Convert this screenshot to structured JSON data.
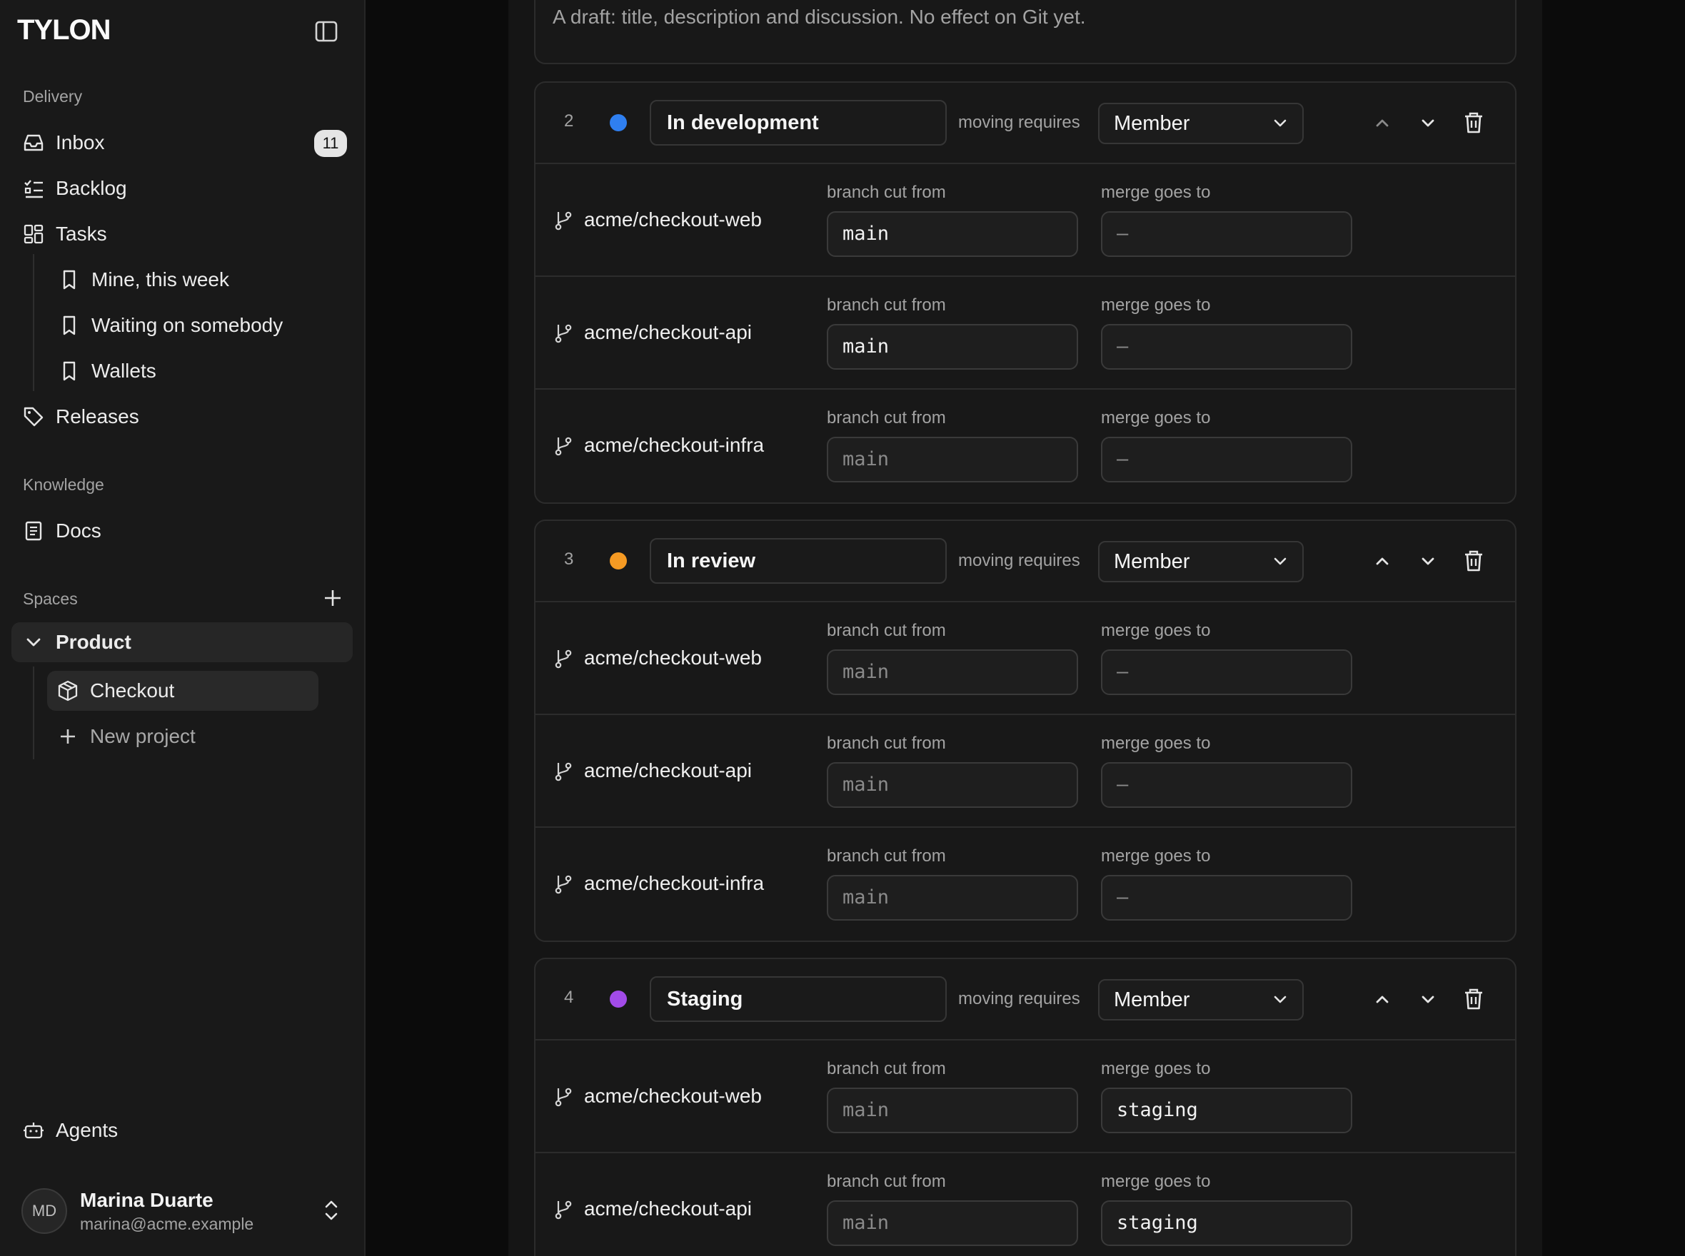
{
  "sidebar": {
    "logo": "TYLON",
    "sections": {
      "delivery": "Delivery",
      "knowledge": "Knowledge",
      "spaces": "Spaces"
    },
    "inbox": {
      "label": "Inbox",
      "count": "11"
    },
    "backlog": "Backlog",
    "tasks": "Tasks",
    "views": [
      "Mine, this week",
      "Waiting on somebody",
      "Wallets"
    ],
    "releases": "Releases",
    "docs": "Docs",
    "product": "Product",
    "checkout": "Checkout",
    "new_project": "New project",
    "agents": "Agents",
    "user": {
      "initials": "MD",
      "name": "Marina Duarte",
      "email": "marina@acme.example"
    }
  },
  "draft_description": "A draft: title, description and discussion. No effect on Git yet.",
  "labels": {
    "moving_requires": "moving requires",
    "branch_cut_from": "branch cut from",
    "merge_goes_to": "merge goes to"
  },
  "stages": [
    {
      "number": "2",
      "name": "In development",
      "color": "#2f7ff0",
      "role": "Member",
      "repos": [
        {
          "name": "acme/checkout-web",
          "cut_from": "main",
          "merge_to": "—"
        },
        {
          "name": "acme/checkout-api",
          "cut_from": "main",
          "merge_to": "—"
        },
        {
          "name": "acme/checkout-infra",
          "cut_from": "main",
          "merge_to": "—"
        }
      ]
    },
    {
      "number": "3",
      "name": "In review",
      "color": "#f59a23",
      "role": "Member",
      "repos": [
        {
          "name": "acme/checkout-web",
          "cut_from": "main",
          "merge_to": "—"
        },
        {
          "name": "acme/checkout-api",
          "cut_from": "main",
          "merge_to": "—"
        },
        {
          "name": "acme/checkout-infra",
          "cut_from": "main",
          "merge_to": "—"
        }
      ]
    },
    {
      "number": "4",
      "name": "Staging",
      "color": "#a24be8",
      "role": "Member",
      "repos": [
        {
          "name": "acme/checkout-web",
          "cut_from": "main",
          "merge_to": "staging"
        },
        {
          "name": "acme/checkout-api",
          "cut_from": "main",
          "merge_to": "staging"
        }
      ]
    }
  ]
}
